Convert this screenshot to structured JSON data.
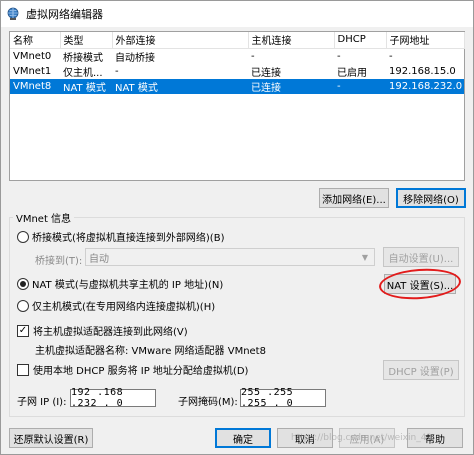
{
  "window": {
    "title": "虚拟网络编辑器"
  },
  "table": {
    "headers": [
      "名称",
      "类型",
      "外部连接",
      "主机连接",
      "DHCP",
      "子网地址"
    ],
    "rows": [
      [
        "VMnet0",
        "桥接模式",
        "自动桥接",
        "-",
        "-",
        "-"
      ],
      [
        "VMnet1",
        "仅主机...",
        "-",
        "已连接",
        "已启用",
        "192.168.15.0"
      ],
      [
        "VMnet8",
        "NAT 模式",
        "NAT 模式",
        "已连接",
        "-",
        "192.168.232.0"
      ]
    ],
    "selected_row": 2
  },
  "buttons": {
    "add_network": "添加网络(E)...",
    "remove_network": "移除网络(O)",
    "auto_settings": "自动设置(U)...",
    "nat_settings": "NAT 设置(S)...",
    "dhcp_settings": "DHCP 设置(P)",
    "restore_defaults": "还原默认设置(R)",
    "ok": "确定",
    "cancel": "取消",
    "apply": "应用(A)",
    "help": "帮助"
  },
  "vmnet_info": {
    "group_label": "VMnet 信息",
    "bridge_mode_label": "桥接模式(将虚拟机直接连接到外部网络)(B)",
    "bridge_to_label": "桥接到(T):",
    "bridge_to_value": "自动",
    "nat_mode_label": "NAT 模式(与虚拟机共享主机的 IP 地址)(N)",
    "host_only_label": "仅主机模式(在专用网络内连接虚拟机)(H)",
    "selected_mode": "nat",
    "connect_adapter_label": "将主机虚拟适配器连接到此网络(V)",
    "connect_adapter_checked": true,
    "adapter_name_label": "主机虚拟适配器名称: VMware 网络适配器 VMnet8",
    "use_dhcp_label": "使用本地 DHCP 服务将 IP 地址分配给虚拟机(D)",
    "use_dhcp_checked": false,
    "subnet_ip_label": "子网 IP (I):",
    "subnet_ip": "192 .168 .232 . 0",
    "subnet_mask_label": "子网掩码(M):",
    "subnet_mask": "255 .255 .255 . 0"
  },
  "watermark": "https://blog.csdn.net/weixin_43...",
  "colors": {
    "selection": "#0078d7",
    "annotation": "#e21b1b"
  }
}
